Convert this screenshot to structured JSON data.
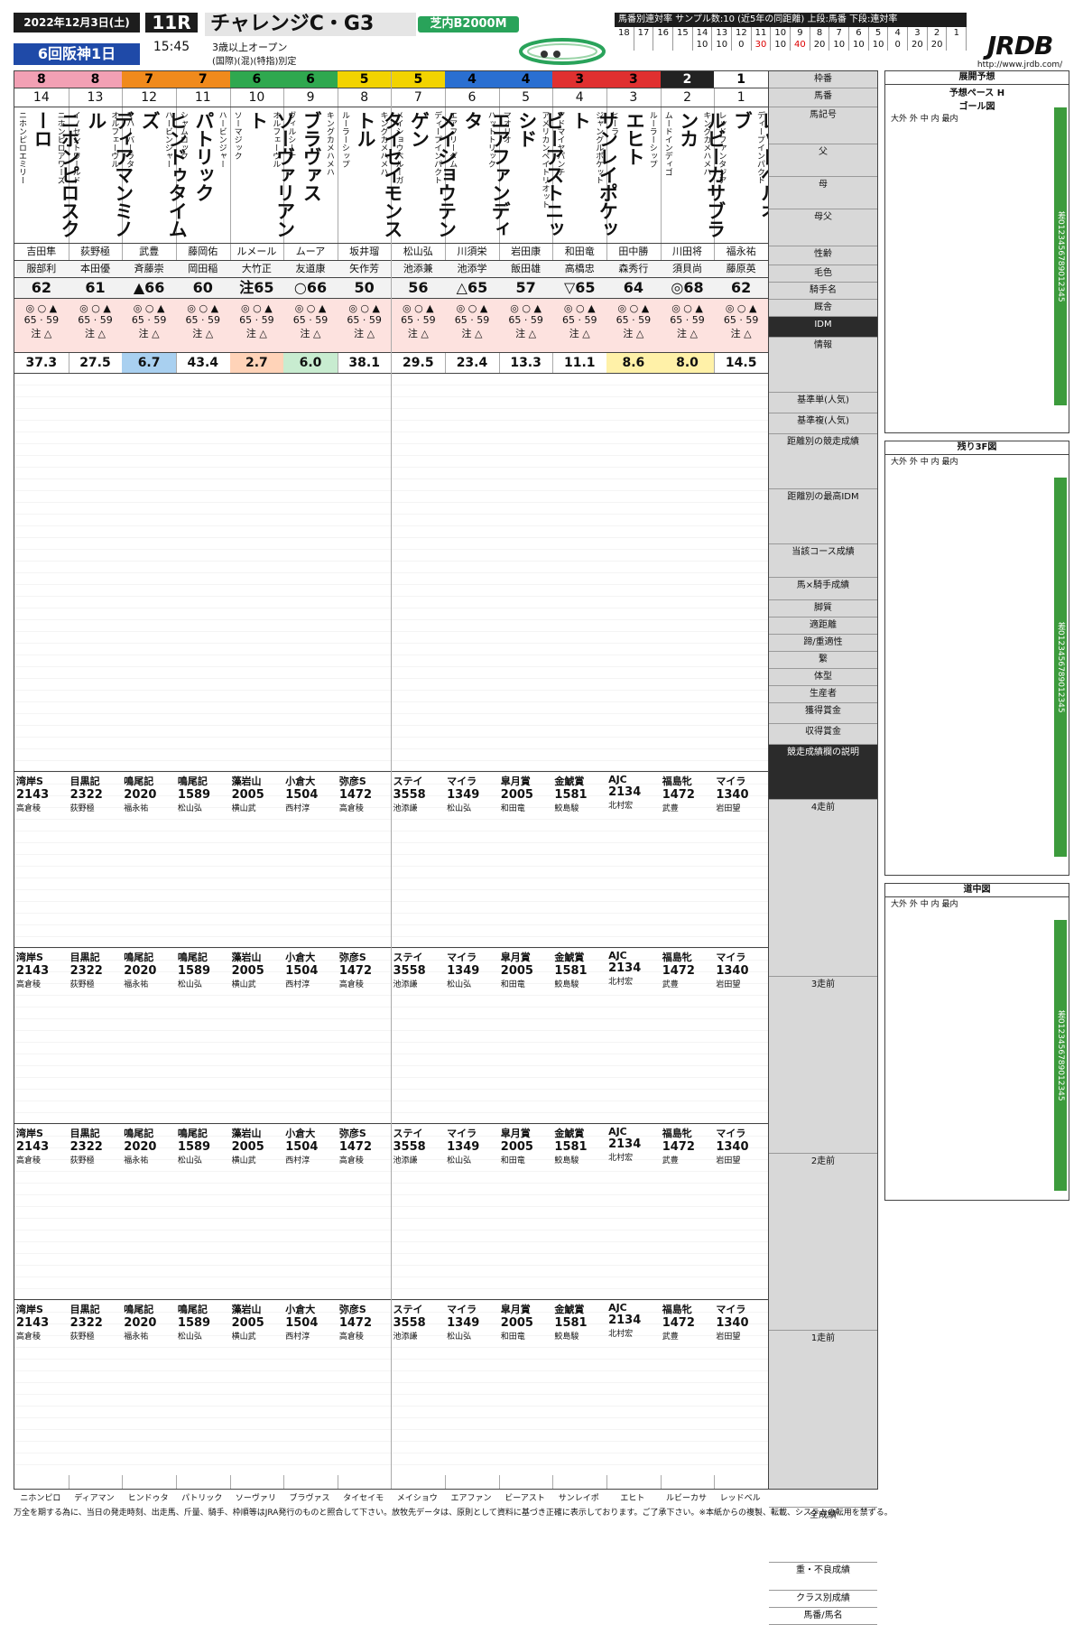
{
  "header": {
    "date": "2022年12月3日(土)",
    "meeting": "6回阪神1日",
    "race_no": "11R",
    "post_time": "15:45",
    "race_name": "チャレンジC・G3",
    "cond1": "3歳以上オープン",
    "cond2": "(国際)(混)(特指)別定",
    "course": "芝内B2000M",
    "stats_title": "馬番別連対率 サンプル数:10 (近5年の同距離) 上段:馬番 下段:連対率",
    "stats_top": [
      "18",
      "17",
      "16",
      "15",
      "14",
      "13",
      "12",
      "11",
      "10",
      "9",
      "8",
      "7",
      "6",
      "5",
      "4",
      "3",
      "2",
      "1"
    ],
    "stats_bottom": [
      "",
      "",
      "",
      "",
      "10",
      "10",
      "0",
      "30",
      "10",
      "40",
      "20",
      "10",
      "10",
      "10",
      "0",
      "20",
      "20",
      ""
    ],
    "logo": "JRDB",
    "url": "http://www.jrdb.com/"
  },
  "horses": [
    {
      "waku": "8",
      "no": "14",
      "name": "ニホンピロスクーロ",
      "sire": "ニホンピロアワーズ",
      "dam": "ニホンピロエミリー",
      "jockey": "吉田隼",
      "trainer": "服部利",
      "idm": "62",
      "odds": "37.3",
      "cls": ""
    },
    {
      "waku": "8",
      "no": "13",
      "name": "ディアマンミノル",
      "sire": "オルフェーヴル",
      "dam": "イノセントワールド",
      "jockey": "荻野極",
      "trainer": "本田優",
      "idm": "61",
      "odds": "27.5",
      "cls": ""
    },
    {
      "waku": "7",
      "no": "12",
      "name": "ヒンドゥタイムズ",
      "sire": "ハービンジャー",
      "dam": "マハーバーラタ",
      "jockey": "武豊",
      "trainer": "斉藤崇",
      "idm": "▲66",
      "odds": "6.7",
      "cls": "hi3"
    },
    {
      "waku": "7",
      "no": "11",
      "name": "パトリック",
      "sire": "ハービンジャー",
      "dam": "シャムロック",
      "jockey": "藤岡佑",
      "trainer": "岡田稲",
      "idm": "60",
      "odds": "43.4",
      "cls": ""
    },
    {
      "waku": "6",
      "no": "10",
      "name": "ソーヴァリアント",
      "sire": "オルフェーヴル",
      "dam": "ソーマジック",
      "jockey": "ルメール",
      "trainer": "大竹正",
      "idm": "注65",
      "odds": "2.7",
      "cls": "hi2"
    },
    {
      "waku": "6",
      "no": "9",
      "name": "ブラヴァス",
      "sire": "キングカメハメハ",
      "dam": "ヴィルシーナ",
      "jockey": "ムーア",
      "trainer": "友道康",
      "idm": "○66",
      "odds": "6.0",
      "cls": "hi4"
    },
    {
      "waku": "5",
      "no": "8",
      "name": "タイセイモンストル",
      "sire": "キングカメハメハ",
      "dam": "ルーラーシップ",
      "jockey": "坂井瑠",
      "trainer": "矢作芳",
      "idm": "50",
      "odds": "38.1",
      "cls": ""
    },
    {
      "waku": "5",
      "no": "7",
      "name": "メイショウテンゲン",
      "sire": "ディープインパクト",
      "dam": "メイショウベルーガ",
      "jockey": "松山弘",
      "trainer": "池添兼",
      "idm": "56",
      "odds": "29.5",
      "cls": ""
    },
    {
      "waku": "4",
      "no": "6",
      "name": "エアファンディタ",
      "sire": "ハットトリック",
      "dam": "エアフリーダム",
      "jockey": "川須栄",
      "trainer": "池添学",
      "idm": "△65",
      "odds": "23.4",
      "cls": ""
    },
    {
      "waku": "4",
      "no": "5",
      "name": "ビーアストニッシド",
      "sire": "アメリカンペイトリオット",
      "dam": "マオリオ",
      "jockey": "岩田康",
      "trainer": "飯田雄",
      "idm": "57",
      "odds": "13.3",
      "cls": ""
    },
    {
      "waku": "3",
      "no": "4",
      "name": "サンレイポケット",
      "sire": "ジャングルポケット",
      "dam": "アドマイヤパンチ",
      "jockey": "和田竜",
      "trainer": "高橋忠",
      "idm": "▽65",
      "odds": "11.1",
      "cls": ""
    },
    {
      "waku": "3",
      "no": "3",
      "name": "エヒト",
      "sire": "ルーラーシップ",
      "dam": "ヒーラ",
      "jockey": "田中勝",
      "trainer": "森秀行",
      "idm": "64",
      "odds": "8.6",
      "cls": "hi"
    },
    {
      "waku": "2",
      "no": "2",
      "name": "ルビーカサブランカ",
      "sire": "キングカメハメハ",
      "dam": "ムードインディゴ",
      "jockey": "川田将",
      "trainer": "須貝尚",
      "idm": "◎68",
      "odds": "8.0",
      "cls": "hi"
    },
    {
      "waku": "1",
      "no": "1",
      "name": "レッドベルオーブ",
      "sire": "ディープインパクト",
      "dam": "レッドファンタジア",
      "jockey": "福永祐",
      "trainer": "藤原英",
      "idm": "62",
      "odds": "14.5",
      "cls": ""
    }
  ],
  "waku_colors": {
    "1": "#ffffff",
    "2": "#222222",
    "3": "#e03030",
    "4": "#2a6fd1",
    "5": "#f2d300",
    "6": "#2fa84f",
    "7": "#f08a1c",
    "8": "#f2a0b4"
  },
  "labels": [
    "枠番",
    "馬番",
    "馬記号",
    "父",
    "母",
    "母父",
    "性齢",
    "毛色",
    "騎手名",
    "厩舎",
    "IDM",
    "情報",
    "基準単(人気)",
    "基準複(人気)",
    "距離別の競走成績",
    "距離別の最高IDM",
    "当該コース成績",
    "馬×騎手成績",
    "脚質",
    "適距離",
    "蹄/重適性",
    "繋",
    "体型",
    "生産者",
    "獲得賞金",
    "収得賞金",
    "競走成績欄の説明",
    "4走前",
    "3走前",
    "2走前",
    "1走前",
    "全成績",
    "重・不良成績",
    "クラス別成績",
    "馬番/馬名"
  ],
  "side": {
    "pace_title": "展開予想",
    "pace": "予想ペース H",
    "goal": "ゴール図",
    "l3f": "残り3F図",
    "mid": "道中図",
    "axis": "大外 外 中 内 最内"
  },
  "past_runs": [
    {
      "label": "4走前"
    },
    {
      "label": "3走前"
    },
    {
      "label": "2走前"
    },
    {
      "label": "1走前"
    }
  ],
  "past_samples": [
    [
      "湾岸S",
      "2143",
      "高倉稜"
    ],
    [
      "目黒記",
      "2322",
      "荻野極"
    ],
    [
      "鳴尾記",
      "2020",
      "福永祐"
    ],
    [
      "鳴尾記",
      "1589",
      "松山弘"
    ],
    [
      "藻岩山",
      "2005",
      "横山武"
    ],
    [
      "小倉大",
      "1504",
      "西村淳"
    ],
    [
      "弥彦S",
      "1472",
      "高倉稜"
    ],
    [
      "ステイ",
      "3558",
      "池添謙"
    ],
    [
      "マイラ",
      "1349",
      "松山弘"
    ],
    [
      "皐月賞",
      "2005",
      "和田竜"
    ],
    [
      "金鯱賞",
      "1581",
      "鮫島駿"
    ],
    [
      "AJC",
      "2134",
      "北村宏"
    ],
    [
      "福島牝",
      "1472",
      "武豊"
    ],
    [
      "マイラ",
      "1340",
      "岩田望"
    ]
  ],
  "footer": {
    "bottom_names": [
      "ニホンピロ",
      "ディアマン",
      "ヒンドゥタ",
      "パトリック",
      "ソーヴァリ",
      "ブラヴァス",
      "タイセイモ",
      "メイショウ",
      "エアファン",
      "ビーアスト",
      "サンレイポ",
      "エヒト",
      "ルビーカサ",
      "レッドベル"
    ],
    "note": "万全を期する為に、当日の発走時刻、出走馬、斤量、騎手、枠順等はJRA発行のものと照合して下さい。放牧先データは、原則として資料に基づき正確に表示しております。ご了承下さい。※本紙からの複製、転載、システムの転用を禁ずる。"
  }
}
